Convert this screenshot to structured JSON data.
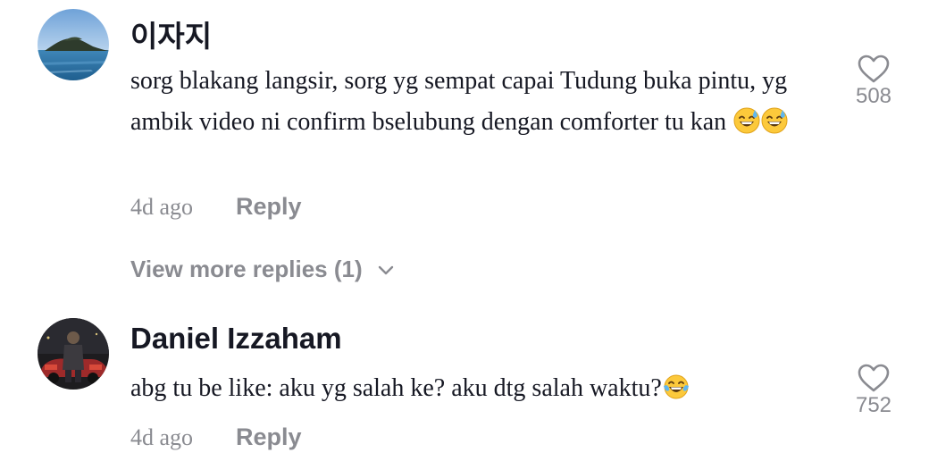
{
  "comments": [
    {
      "author": "이자지",
      "text": "sorg blakang langsir, sorg yg sempat capai Tudung buka pintu, yg ambik video ni confirm bselubung dengan comforter tu kan",
      "emoji": [
        "sweat-smile-emoji",
        "sweat-smile-emoji"
      ],
      "time": "4d ago",
      "reply_label": "Reply",
      "likes": "508",
      "avatar_icon": "island-sea-avatar"
    },
    {
      "author": "Daniel Izzaham",
      "text": "abg tu be like: aku yg salah ke? aku dtg salah waktu?",
      "emoji": [
        "tears-of-joy-emoji"
      ],
      "time": "4d ago",
      "reply_label": "Reply",
      "likes": "752",
      "avatar_icon": "person-with-car-avatar"
    }
  ],
  "view_more_replies": "View more replies (1)",
  "colors": {
    "primary_text": "#161823",
    "secondary_text": "#8a8b91",
    "background": "#ffffff"
  }
}
